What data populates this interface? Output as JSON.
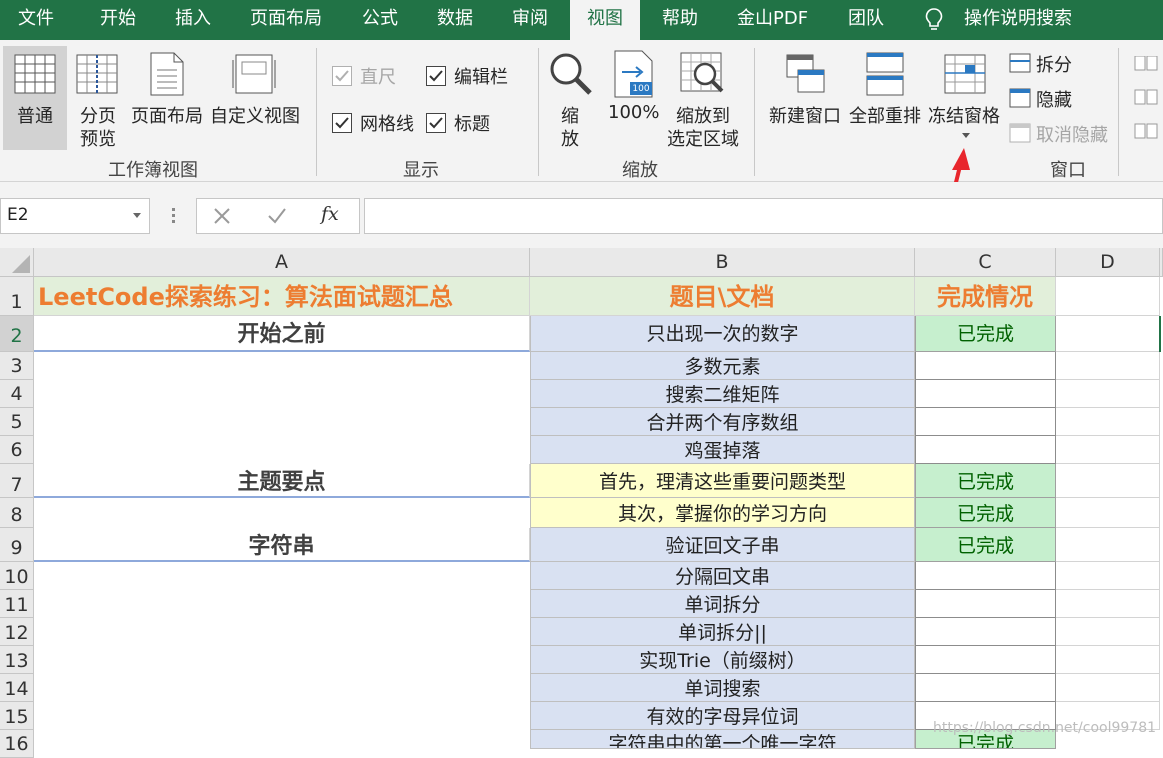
{
  "tabs": [
    "文件",
    "开始",
    "插入",
    "页面布局",
    "公式",
    "数据",
    "审阅",
    "视图",
    "帮助",
    "金山PDF",
    "团队",
    "操作说明搜索"
  ],
  "active_tab": "视图",
  "ribbon": {
    "workbook_views": {
      "normal": "普通",
      "page_break_1": "分页",
      "page_break_2": "预览",
      "page_layout": "页面布局",
      "custom_views": "自定义视图",
      "group": "工作簿视图"
    },
    "show": {
      "ruler": "直尺",
      "formula_bar": "编辑栏",
      "gridlines": "网格线",
      "headings": "标题",
      "group": "显示"
    },
    "zoom": {
      "zoom_1": "缩",
      "zoom_2": "放",
      "hundred": "100%",
      "icon_100": "100",
      "to_selection_1": "缩放到",
      "to_selection_2": "选定区域",
      "group": "缩放"
    },
    "window": {
      "new_window": "新建窗口",
      "arrange_all": "全部重排",
      "freeze_panes": "冻结窗格",
      "split": "拆分",
      "hide": "隐藏",
      "unhide": "取消隐藏",
      "group": "窗口"
    }
  },
  "formula_bar": {
    "name_box": "E2",
    "fx": "fx",
    "content": ""
  },
  "columns": [
    "A",
    "B",
    "C",
    "D"
  ],
  "rows": [
    "1",
    "2",
    "3",
    "4",
    "5",
    "6",
    "7",
    "8",
    "9",
    "10",
    "11",
    "12",
    "13",
    "14",
    "15",
    "16"
  ],
  "sheet": {
    "header": {
      "a": "LeetCode探索练习：算法面试题汇总",
      "b": "题目\\文档",
      "c": "完成情况"
    },
    "sections": {
      "before": "开始之前",
      "key_points": "主题要点",
      "strings": "字符串"
    },
    "problems": [
      "只出现一次的数字",
      "多数元素",
      "搜索二维矩阵",
      "合并两个有序数组",
      "鸡蛋掉落",
      "首先，理清这些重要问题类型",
      "其次，掌握你的学习方向",
      "验证回文子串",
      "分隔回文串",
      "单词拆分",
      "单词拆分||",
      "实现Trie（前缀树）",
      "单词搜索",
      "有效的字母异位词",
      "字符串中的第一个唯一字符"
    ],
    "status": {
      "r2": "已完成",
      "r7": "已完成",
      "r8": "已完成",
      "r9": "已完成",
      "r16": "已完成"
    }
  },
  "watermark": "https://blog.csdn.net/cool99781"
}
